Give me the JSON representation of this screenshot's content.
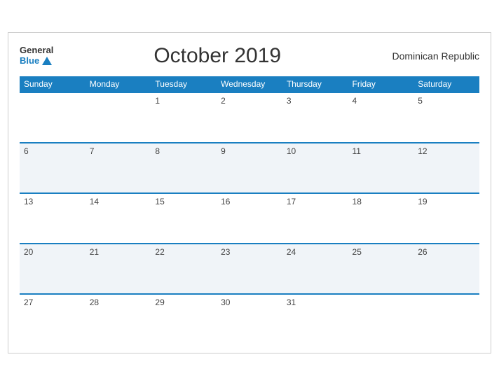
{
  "header": {
    "logo_general": "General",
    "logo_blue": "Blue",
    "month_title": "October 2019",
    "country": "Dominican Republic"
  },
  "weekdays": [
    "Sunday",
    "Monday",
    "Tuesday",
    "Wednesday",
    "Thursday",
    "Friday",
    "Saturday"
  ],
  "weeks": [
    [
      "",
      "",
      "1",
      "2",
      "3",
      "4",
      "5"
    ],
    [
      "6",
      "7",
      "8",
      "9",
      "10",
      "11",
      "12"
    ],
    [
      "13",
      "14",
      "15",
      "16",
      "17",
      "18",
      "19"
    ],
    [
      "20",
      "21",
      "22",
      "23",
      "24",
      "25",
      "26"
    ],
    [
      "27",
      "28",
      "29",
      "30",
      "31",
      "",
      ""
    ]
  ]
}
